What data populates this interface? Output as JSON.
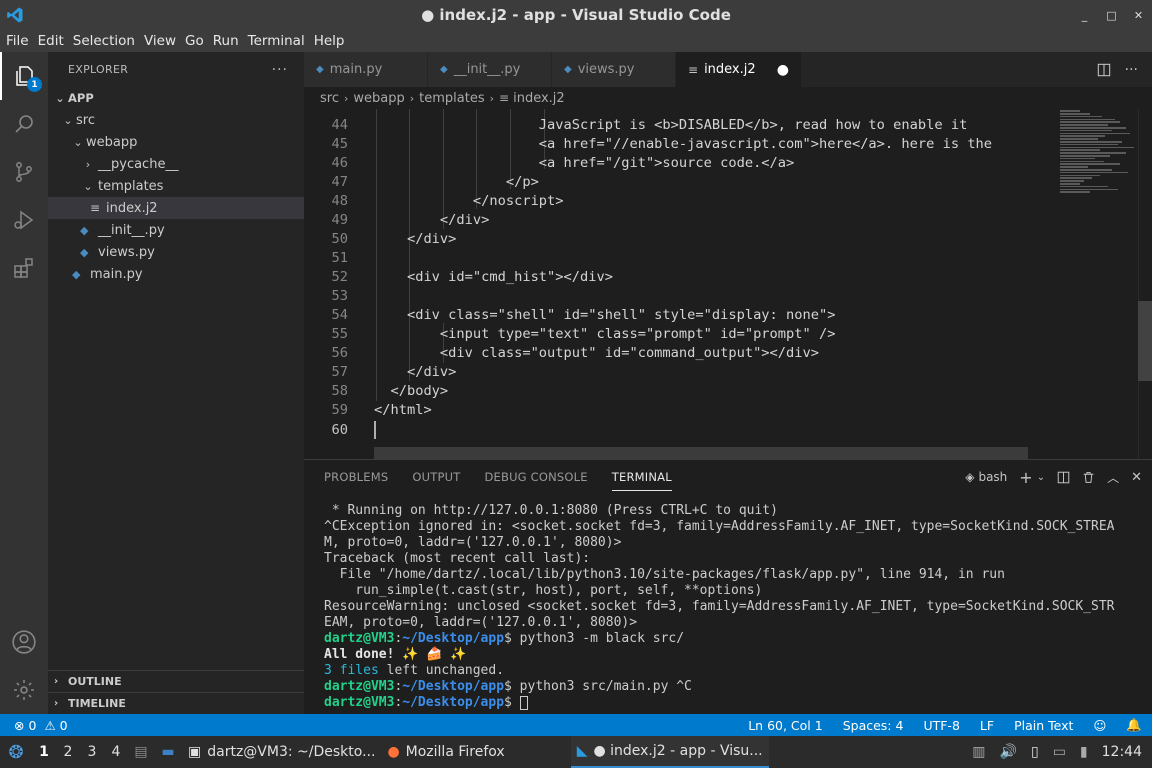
{
  "window": {
    "title": "● index.j2 - app - Visual Studio Code",
    "controls": [
      "_",
      "□",
      "✕"
    ]
  },
  "menu": [
    "File",
    "Edit",
    "Selection",
    "View",
    "Go",
    "Run",
    "Terminal",
    "Help"
  ],
  "activity_badge": "1",
  "explorer": {
    "header": "EXPLORER",
    "more": "···",
    "tree": [
      {
        "label": "APP",
        "chev": "⌄"
      },
      {
        "label": "src",
        "chev": "⌄"
      },
      {
        "label": "webapp",
        "chev": "⌄"
      },
      {
        "label": "__pycache__",
        "chev": "›"
      },
      {
        "label": "templates",
        "chev": "⌄"
      },
      {
        "label": "index.j2",
        "chev": ""
      },
      {
        "label": "__init__.py",
        "chev": ""
      },
      {
        "label": "views.py",
        "chev": ""
      },
      {
        "label": "main.py",
        "chev": ""
      }
    ],
    "outline": "OUTLINE",
    "timeline": "TIMELINE"
  },
  "tabs": [
    {
      "label": "main.py"
    },
    {
      "label": "__init__.py"
    },
    {
      "label": "views.py"
    },
    {
      "label": "index.j2",
      "dirty": "●"
    }
  ],
  "breadcrumb": [
    "src",
    "webapp",
    "templates",
    "index.j2"
  ],
  "code": {
    "lines": [
      {
        "n": "44",
        "text": "                    JavaScript is <b>DISABLED</b>, read how to enable it"
      },
      {
        "n": "45",
        "text": "                    <a href=\"//enable-javascript.com\">here</a>. here is the"
      },
      {
        "n": "46",
        "text": "                    <a href=\"/git\">source code.</a>"
      },
      {
        "n": "47",
        "text": "                </p>"
      },
      {
        "n": "48",
        "text": "            </noscript>"
      },
      {
        "n": "49",
        "text": "        </div>"
      },
      {
        "n": "50",
        "text": "    </div>"
      },
      {
        "n": "51",
        "text": ""
      },
      {
        "n": "52",
        "text": "    <div id=\"cmd_hist\"></div>"
      },
      {
        "n": "53",
        "text": ""
      },
      {
        "n": "54",
        "text": "    <div class=\"shell\" id=\"shell\" style=\"display: none\">"
      },
      {
        "n": "55",
        "text": "        <input type=\"text\" class=\"prompt\" id=\"prompt\" />"
      },
      {
        "n": "56",
        "text": "        <div class=\"output\" id=\"command_output\"></div>"
      },
      {
        "n": "57",
        "text": "    </div>"
      },
      {
        "n": "58",
        "text": "  </body>"
      },
      {
        "n": "59",
        "text": "</html>"
      },
      {
        "n": "60",
        "text": ""
      }
    ]
  },
  "panel": {
    "tabs": [
      "PROBLEMS",
      "OUTPUT",
      "DEBUG CONSOLE",
      "TERMINAL"
    ],
    "shell": "bash",
    "terminal": {
      "l1": " * Running on http://127.0.0.1:8080 (Press CTRL+C to quit)",
      "l2": "^CException ignored in: <socket.socket fd=3, family=AddressFamily.AF_INET, type=SocketKind.SOCK_STREA",
      "l3": "M, proto=0, laddr=('127.0.0.1', 8080)>",
      "l4": "Traceback (most recent call last):",
      "l5": "  File \"/home/dartz/.local/lib/python3.10/site-packages/flask/app.py\", line 914, in run",
      "l6": "    run_simple(t.cast(str, host), port, self, **options)",
      "l7": "ResourceWarning: unclosed <socket.socket fd=3, family=AddressFamily.AF_INET, type=SocketKind.SOCK_STR",
      "l8": "EAM, proto=0, laddr=('127.0.0.1', 8080)>",
      "prompt_user": "dartz@VM3",
      "prompt_path": "~/Desktop/app",
      "cmd1": "$ python3 -m black src/",
      "done": "All done!",
      "done_icons": " ✨ 🍰 ✨",
      "files_count": "3 files",
      "files_rest": " left unchanged.",
      "cmd2": "$ python3 src/main.py ^C",
      "cmd3": "$ "
    }
  },
  "status": {
    "errors": "0",
    "warnings": "0",
    "position": "Ln 60, Col 1",
    "spaces": "Spaces: 4",
    "encoding": "UTF-8",
    "eol": "LF",
    "language": "Plain Text"
  },
  "taskbar": {
    "workspaces": [
      "1",
      "2",
      "3",
      "4"
    ],
    "tasks": [
      {
        "label": "dartz@VM3: ~/Deskto..."
      },
      {
        "label": "Mozilla Firefox"
      },
      {
        "label": "● index.j2 - app - Visu..."
      }
    ],
    "clock": "12:44"
  }
}
